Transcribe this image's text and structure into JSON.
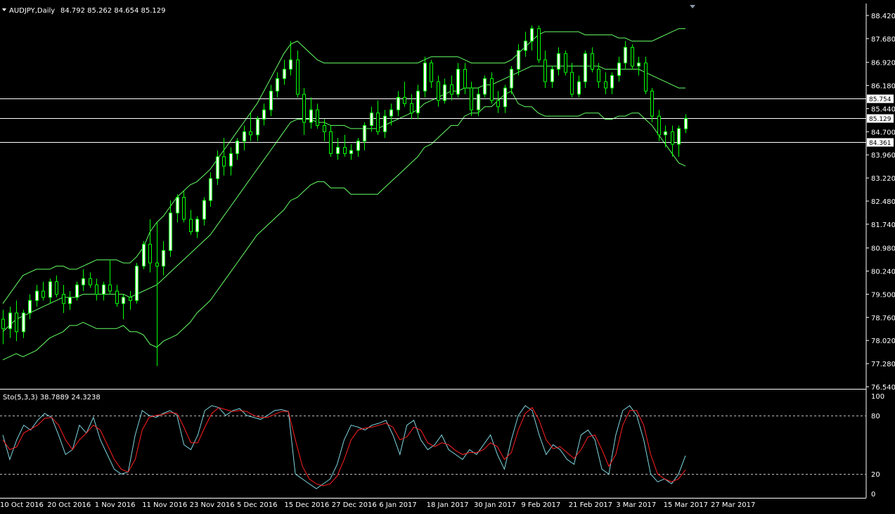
{
  "main": {
    "symbol": "AUDJPY,Daily",
    "ohlc": "84.792 85.262 84.654 85.129",
    "price_ticks": [
      "88.420",
      "87.680",
      "86.920",
      "86.180",
      "85.440",
      "84.700",
      "83.960",
      "83.220",
      "82.480",
      "81.740",
      "80.980",
      "80.240",
      "79.500",
      "78.760",
      "78.020",
      "77.280",
      "76.540"
    ],
    "hline_tags": [
      "85.754",
      "85.129",
      "84.361"
    ]
  },
  "stoch": {
    "label": "Sto(5,3,3) 38.7889 24.3238",
    "ticks": [
      "100",
      "80",
      "20",
      "0"
    ]
  },
  "time_axis": {
    "labels": [
      "10 Oct 2016",
      "20 Oct 2016",
      "1 Nov 2016",
      "11 Nov 2016",
      "23 Nov 2016",
      "5 Dec 2016",
      "15 Dec 2016",
      "27 Dec 2016",
      "6 Jan 2017",
      "18 Jan 2017",
      "30 Jan 2017",
      "9 Feb 2017",
      "21 Feb 2017",
      "3 Mar 2017",
      "15 Mar 2017",
      "27 Mar 2017"
    ]
  },
  "chart_data": {
    "type": "candlestick",
    "symbol": "AUDJPY",
    "timeframe": "Daily",
    "ylim": [
      76.54,
      88.42
    ],
    "price_lines": [
      85.754,
      85.129,
      84.361
    ],
    "colors": {
      "background": "#000000",
      "bull_candle": "#ffffff",
      "bear_candle": "#000000",
      "wick": "#00ff00",
      "bollinger": "#66ff66",
      "stoch_main": "#7fd6e0",
      "stoch_signal": "#ff2020",
      "grid_text": "#ffffff"
    },
    "candles": [
      {
        "o": 78.7,
        "h": 79.0,
        "l": 77.9,
        "c": 78.4
      },
      {
        "o": 78.4,
        "h": 79.1,
        "l": 78.1,
        "c": 78.9
      },
      {
        "o": 78.9,
        "h": 79.3,
        "l": 78.0,
        "c": 78.3
      },
      {
        "o": 78.3,
        "h": 79.0,
        "l": 78.1,
        "c": 78.9
      },
      {
        "o": 78.9,
        "h": 79.5,
        "l": 78.7,
        "c": 79.3
      },
      {
        "o": 79.3,
        "h": 79.8,
        "l": 79.1,
        "c": 79.6
      },
      {
        "o": 79.6,
        "h": 79.9,
        "l": 79.3,
        "c": 79.4
      },
      {
        "o": 79.4,
        "h": 80.0,
        "l": 79.2,
        "c": 79.9
      },
      {
        "o": 79.9,
        "h": 80.1,
        "l": 79.4,
        "c": 79.5
      },
      {
        "o": 79.5,
        "h": 79.8,
        "l": 78.9,
        "c": 79.2
      },
      {
        "o": 79.2,
        "h": 79.6,
        "l": 79.0,
        "c": 79.4
      },
      {
        "o": 79.4,
        "h": 79.9,
        "l": 79.3,
        "c": 79.8
      },
      {
        "o": 79.8,
        "h": 80.3,
        "l": 79.6,
        "c": 80.0
      },
      {
        "o": 80.0,
        "h": 80.2,
        "l": 79.7,
        "c": 79.8
      },
      {
        "o": 79.8,
        "h": 80.0,
        "l": 79.3,
        "c": 79.5
      },
      {
        "o": 79.5,
        "h": 79.9,
        "l": 79.3,
        "c": 79.8
      },
      {
        "o": 79.8,
        "h": 80.6,
        "l": 79.5,
        "c": 79.6
      },
      {
        "o": 79.6,
        "h": 79.8,
        "l": 79.1,
        "c": 79.2
      },
      {
        "o": 79.2,
        "h": 79.5,
        "l": 78.7,
        "c": 79.4
      },
      {
        "o": 79.4,
        "h": 79.6,
        "l": 79.0,
        "c": 79.3
      },
      {
        "o": 79.3,
        "h": 80.5,
        "l": 79.2,
        "c": 80.4
      },
      {
        "o": 80.4,
        "h": 81.2,
        "l": 80.3,
        "c": 81.1
      },
      {
        "o": 81.1,
        "h": 81.9,
        "l": 80.2,
        "c": 80.5
      },
      {
        "o": 80.5,
        "h": 81.8,
        "l": 77.2,
        "c": 80.4
      },
      {
        "o": 80.4,
        "h": 81.2,
        "l": 80.1,
        "c": 80.9
      },
      {
        "o": 80.9,
        "h": 82.5,
        "l": 80.7,
        "c": 82.1
      },
      {
        "o": 82.1,
        "h": 82.7,
        "l": 81.8,
        "c": 82.6
      },
      {
        "o": 82.6,
        "h": 82.8,
        "l": 81.8,
        "c": 81.9
      },
      {
        "o": 81.9,
        "h": 82.2,
        "l": 81.4,
        "c": 81.5
      },
      {
        "o": 81.5,
        "h": 82.0,
        "l": 81.3,
        "c": 81.9
      },
      {
        "o": 81.9,
        "h": 82.6,
        "l": 81.7,
        "c": 82.5
      },
      {
        "o": 82.5,
        "h": 83.4,
        "l": 82.3,
        "c": 83.2
      },
      {
        "o": 83.2,
        "h": 84.1,
        "l": 83.0,
        "c": 83.9
      },
      {
        "o": 83.9,
        "h": 84.5,
        "l": 83.3,
        "c": 83.6
      },
      {
        "o": 83.6,
        "h": 84.2,
        "l": 83.3,
        "c": 84.0
      },
      {
        "o": 84.0,
        "h": 84.5,
        "l": 83.8,
        "c": 84.4
      },
      {
        "o": 84.4,
        "h": 84.9,
        "l": 84.1,
        "c": 84.7
      },
      {
        "o": 84.7,
        "h": 85.3,
        "l": 84.4,
        "c": 84.6
      },
      {
        "o": 84.6,
        "h": 85.2,
        "l": 84.4,
        "c": 85.1
      },
      {
        "o": 85.1,
        "h": 85.6,
        "l": 84.9,
        "c": 85.4
      },
      {
        "o": 85.4,
        "h": 86.2,
        "l": 85.2,
        "c": 86.0
      },
      {
        "o": 86.0,
        "h": 86.6,
        "l": 85.8,
        "c": 86.4
      },
      {
        "o": 86.4,
        "h": 87.0,
        "l": 86.2,
        "c": 86.7
      },
      {
        "o": 86.7,
        "h": 87.6,
        "l": 86.5,
        "c": 87.0
      },
      {
        "o": 87.0,
        "h": 87.3,
        "l": 85.8,
        "c": 85.9
      },
      {
        "o": 85.9,
        "h": 86.1,
        "l": 84.6,
        "c": 85.0
      },
      {
        "o": 85.0,
        "h": 85.8,
        "l": 84.8,
        "c": 85.4
      },
      {
        "o": 85.4,
        "h": 85.6,
        "l": 84.8,
        "c": 84.9
      },
      {
        "o": 84.9,
        "h": 85.1,
        "l": 84.4,
        "c": 84.7
      },
      {
        "o": 84.7,
        "h": 84.9,
        "l": 83.9,
        "c": 84.0
      },
      {
        "o": 84.0,
        "h": 84.5,
        "l": 83.8,
        "c": 84.2
      },
      {
        "o": 84.2,
        "h": 84.6,
        "l": 83.9,
        "c": 84.0
      },
      {
        "o": 84.0,
        "h": 84.3,
        "l": 83.8,
        "c": 84.1
      },
      {
        "o": 84.1,
        "h": 84.5,
        "l": 83.9,
        "c": 84.4
      },
      {
        "o": 84.4,
        "h": 85.0,
        "l": 84.1,
        "c": 84.9
      },
      {
        "o": 84.9,
        "h": 85.5,
        "l": 84.7,
        "c": 85.3
      },
      {
        "o": 85.3,
        "h": 85.7,
        "l": 84.6,
        "c": 84.7
      },
      {
        "o": 84.7,
        "h": 85.4,
        "l": 84.5,
        "c": 85.2
      },
      {
        "o": 85.2,
        "h": 85.6,
        "l": 84.9,
        "c": 85.4
      },
      {
        "o": 85.4,
        "h": 86.0,
        "l": 85.2,
        "c": 85.8
      },
      {
        "o": 85.8,
        "h": 86.3,
        "l": 85.5,
        "c": 85.6
      },
      {
        "o": 85.6,
        "h": 85.9,
        "l": 85.1,
        "c": 85.3
      },
      {
        "o": 85.3,
        "h": 86.2,
        "l": 85.1,
        "c": 86.0
      },
      {
        "o": 86.0,
        "h": 87.1,
        "l": 85.8,
        "c": 86.9
      },
      {
        "o": 86.9,
        "h": 87.0,
        "l": 86.1,
        "c": 86.3
      },
      {
        "o": 86.3,
        "h": 86.5,
        "l": 85.5,
        "c": 85.7
      },
      {
        "o": 85.7,
        "h": 86.4,
        "l": 85.6,
        "c": 86.2
      },
      {
        "o": 86.2,
        "h": 86.5,
        "l": 85.7,
        "c": 85.9
      },
      {
        "o": 85.9,
        "h": 86.9,
        "l": 85.8,
        "c": 86.7
      },
      {
        "o": 86.7,
        "h": 86.9,
        "l": 85.9,
        "c": 86.1
      },
      {
        "o": 86.1,
        "h": 86.3,
        "l": 85.2,
        "c": 85.4
      },
      {
        "o": 85.4,
        "h": 86.1,
        "l": 85.2,
        "c": 85.9
      },
      {
        "o": 85.9,
        "h": 86.5,
        "l": 85.8,
        "c": 86.4
      },
      {
        "o": 86.4,
        "h": 86.6,
        "l": 85.6,
        "c": 85.7
      },
      {
        "o": 85.7,
        "h": 86.0,
        "l": 85.3,
        "c": 85.5
      },
      {
        "o": 85.5,
        "h": 86.2,
        "l": 85.3,
        "c": 86.1
      },
      {
        "o": 86.1,
        "h": 86.8,
        "l": 85.9,
        "c": 86.7
      },
      {
        "o": 86.7,
        "h": 87.5,
        "l": 86.5,
        "c": 87.3
      },
      {
        "o": 87.3,
        "h": 87.9,
        "l": 87.1,
        "c": 87.6
      },
      {
        "o": 87.6,
        "h": 88.1,
        "l": 87.3,
        "c": 88.0
      },
      {
        "o": 88.0,
        "h": 88.1,
        "l": 86.9,
        "c": 87.0
      },
      {
        "o": 87.0,
        "h": 87.3,
        "l": 86.1,
        "c": 86.3
      },
      {
        "o": 86.3,
        "h": 86.8,
        "l": 86.1,
        "c": 86.7
      },
      {
        "o": 86.7,
        "h": 87.4,
        "l": 86.5,
        "c": 87.2
      },
      {
        "o": 87.2,
        "h": 87.3,
        "l": 86.5,
        "c": 86.6
      },
      {
        "o": 86.6,
        "h": 86.9,
        "l": 85.8,
        "c": 85.9
      },
      {
        "o": 85.9,
        "h": 86.5,
        "l": 85.8,
        "c": 86.3
      },
      {
        "o": 86.3,
        "h": 87.3,
        "l": 86.1,
        "c": 87.2
      },
      {
        "o": 87.2,
        "h": 87.4,
        "l": 86.6,
        "c": 86.7
      },
      {
        "o": 86.7,
        "h": 86.9,
        "l": 86.1,
        "c": 86.3
      },
      {
        "o": 86.3,
        "h": 86.6,
        "l": 85.9,
        "c": 86.1
      },
      {
        "o": 86.1,
        "h": 86.6,
        "l": 85.9,
        "c": 86.5
      },
      {
        "o": 86.5,
        "h": 87.1,
        "l": 86.3,
        "c": 86.9
      },
      {
        "o": 86.9,
        "h": 87.6,
        "l": 86.7,
        "c": 87.4
      },
      {
        "o": 87.4,
        "h": 87.5,
        "l": 86.7,
        "c": 86.8
      },
      {
        "o": 86.8,
        "h": 87.1,
        "l": 86.5,
        "c": 86.9
      },
      {
        "o": 86.9,
        "h": 87.1,
        "l": 85.9,
        "c": 86.0
      },
      {
        "o": 86.0,
        "h": 86.1,
        "l": 85.0,
        "c": 85.2
      },
      {
        "o": 85.2,
        "h": 85.4,
        "l": 84.4,
        "c": 84.6
      },
      {
        "o": 84.6,
        "h": 84.9,
        "l": 84.2,
        "c": 84.7
      },
      {
        "o": 84.7,
        "h": 84.9,
        "l": 83.9,
        "c": 84.3
      },
      {
        "o": 84.3,
        "h": 84.9,
        "l": 83.9,
        "c": 84.8
      },
      {
        "o": 84.792,
        "h": 85.262,
        "l": 84.654,
        "c": 85.129
      }
    ],
    "bollinger": {
      "upper": [
        79.2,
        79.5,
        79.8,
        80.1,
        80.2,
        80.3,
        80.3,
        80.3,
        80.4,
        80.4,
        80.3,
        80.3,
        80.4,
        80.5,
        80.6,
        80.6,
        80.6,
        80.6,
        80.5,
        80.5,
        80.7,
        81.0,
        81.5,
        81.8,
        82.0,
        82.3,
        82.6,
        82.8,
        83.0,
        83.1,
        83.3,
        83.5,
        83.8,
        84.1,
        84.4,
        84.7,
        85.0,
        85.3,
        85.6,
        86.0,
        86.4,
        86.8,
        87.2,
        87.5,
        87.6,
        87.4,
        87.2,
        87.0,
        86.9,
        86.9,
        86.9,
        86.9,
        86.9,
        86.9,
        86.9,
        86.9,
        86.9,
        86.9,
        86.9,
        86.9,
        86.9,
        86.9,
        86.9,
        87.0,
        87.1,
        87.1,
        87.1,
        87.1,
        87.1,
        87.0,
        86.9,
        86.9,
        86.9,
        86.9,
        86.9,
        86.9,
        87.0,
        87.2,
        87.4,
        87.6,
        87.8,
        87.9,
        87.9,
        87.9,
        87.9,
        87.9,
        87.9,
        87.8,
        87.8,
        87.8,
        87.8,
        87.8,
        87.7,
        87.7,
        87.6,
        87.6,
        87.6,
        87.6,
        87.7,
        87.8,
        87.9,
        88.0,
        88.0
      ],
      "middle": [
        78.3,
        78.5,
        78.7,
        78.8,
        78.9,
        79.0,
        79.1,
        79.2,
        79.3,
        79.4,
        79.4,
        79.4,
        79.5,
        79.5,
        79.5,
        79.5,
        79.5,
        79.5,
        79.5,
        79.4,
        79.5,
        79.6,
        79.7,
        79.8,
        80.0,
        80.2,
        80.4,
        80.6,
        80.8,
        81.0,
        81.2,
        81.4,
        81.7,
        82.0,
        82.3,
        82.6,
        82.9,
        83.2,
        83.5,
        83.8,
        84.1,
        84.4,
        84.7,
        85.0,
        85.1,
        85.1,
        85.1,
        85.0,
        85.0,
        84.9,
        84.9,
        84.9,
        84.8,
        84.8,
        84.8,
        84.8,
        84.8,
        84.9,
        85.0,
        85.1,
        85.2,
        85.3,
        85.4,
        85.6,
        85.7,
        85.8,
        85.9,
        86.0,
        86.0,
        86.1,
        86.1,
        86.1,
        86.2,
        86.2,
        86.3,
        86.4,
        86.5,
        86.6,
        86.7,
        86.8,
        86.8,
        86.8,
        86.8,
        86.8,
        86.8,
        86.8,
        86.8,
        86.8,
        86.8,
        86.8,
        86.7,
        86.7,
        86.7,
        86.7,
        86.7,
        86.7,
        86.6,
        86.5,
        86.4,
        86.3,
        86.2,
        86.1,
        86.1
      ],
      "lower": [
        77.4,
        77.5,
        77.6,
        77.5,
        77.6,
        77.7,
        77.9,
        78.1,
        78.2,
        78.3,
        78.5,
        78.5,
        78.6,
        78.5,
        78.4,
        78.4,
        78.4,
        78.4,
        78.5,
        78.3,
        78.3,
        78.2,
        77.9,
        77.8,
        78.0,
        78.1,
        78.2,
        78.4,
        78.6,
        78.9,
        79.1,
        79.3,
        79.6,
        79.9,
        80.2,
        80.5,
        80.8,
        81.1,
        81.4,
        81.6,
        81.8,
        82.0,
        82.2,
        82.5,
        82.6,
        82.8,
        83.0,
        83.1,
        83.1,
        82.9,
        82.9,
        82.9,
        82.7,
        82.7,
        82.7,
        82.7,
        82.7,
        82.9,
        83.1,
        83.3,
        83.5,
        83.7,
        83.9,
        84.2,
        84.3,
        84.5,
        84.7,
        84.9,
        84.9,
        85.2,
        85.3,
        85.3,
        85.5,
        85.5,
        85.7,
        85.9,
        86.0,
        85.6,
        85.5,
        85.5,
        85.3,
        85.2,
        85.2,
        85.2,
        85.2,
        85.2,
        85.2,
        85.3,
        85.3,
        85.3,
        85.1,
        85.1,
        85.2,
        85.2,
        85.3,
        85.3,
        85.1,
        84.9,
        84.6,
        84.3,
        84.0,
        83.7,
        83.6
      ]
    },
    "stochastic": {
      "label": "Sto(5,3,3) 38.7889 24.3238",
      "main_value": 38.7889,
      "signal_value": 24.3238,
      "ylim": [
        0,
        100
      ],
      "levels": [
        20,
        80
      ],
      "main": [
        60,
        35,
        55,
        70,
        65,
        75,
        82,
        78,
        60,
        40,
        45,
        70,
        62,
        78,
        55,
        40,
        25,
        20,
        22,
        60,
        85,
        80,
        78,
        82,
        85,
        80,
        50,
        45,
        60,
        85,
        90,
        88,
        80,
        85,
        87,
        80,
        78,
        76,
        80,
        85,
        86,
        84,
        20,
        15,
        10,
        5,
        10,
        15,
        30,
        55,
        70,
        68,
        65,
        70,
        72,
        75,
        60,
        40,
        70,
        75,
        55,
        45,
        50,
        60,
        45,
        40,
        35,
        45,
        40,
        50,
        60,
        40,
        25,
        55,
        80,
        90,
        85,
        60,
        40,
        50,
        45,
        35,
        30,
        60,
        65,
        55,
        25,
        20,
        60,
        85,
        90,
        80,
        55,
        20,
        12,
        15,
        10,
        20,
        38.8
      ],
      "signal": [
        55,
        45,
        48,
        62,
        66,
        70,
        77,
        78,
        70,
        55,
        45,
        55,
        62,
        70,
        65,
        50,
        35,
        25,
        22,
        35,
        65,
        78,
        80,
        81,
        83,
        82,
        68,
        52,
        52,
        68,
        82,
        88,
        86,
        84,
        85,
        84,
        80,
        78,
        78,
        81,
        84,
        84,
        55,
        28,
        15,
        10,
        8,
        10,
        18,
        35,
        55,
        65,
        67,
        68,
        70,
        72,
        68,
        55,
        58,
        68,
        65,
        52,
        48,
        52,
        50,
        44,
        40,
        42,
        42,
        45,
        52,
        48,
        35,
        42,
        65,
        82,
        88,
        75,
        55,
        46,
        48,
        42,
        36,
        45,
        58,
        60,
        45,
        28,
        40,
        70,
        85,
        85,
        70,
        40,
        20,
        15,
        12,
        15,
        24.3
      ]
    }
  }
}
